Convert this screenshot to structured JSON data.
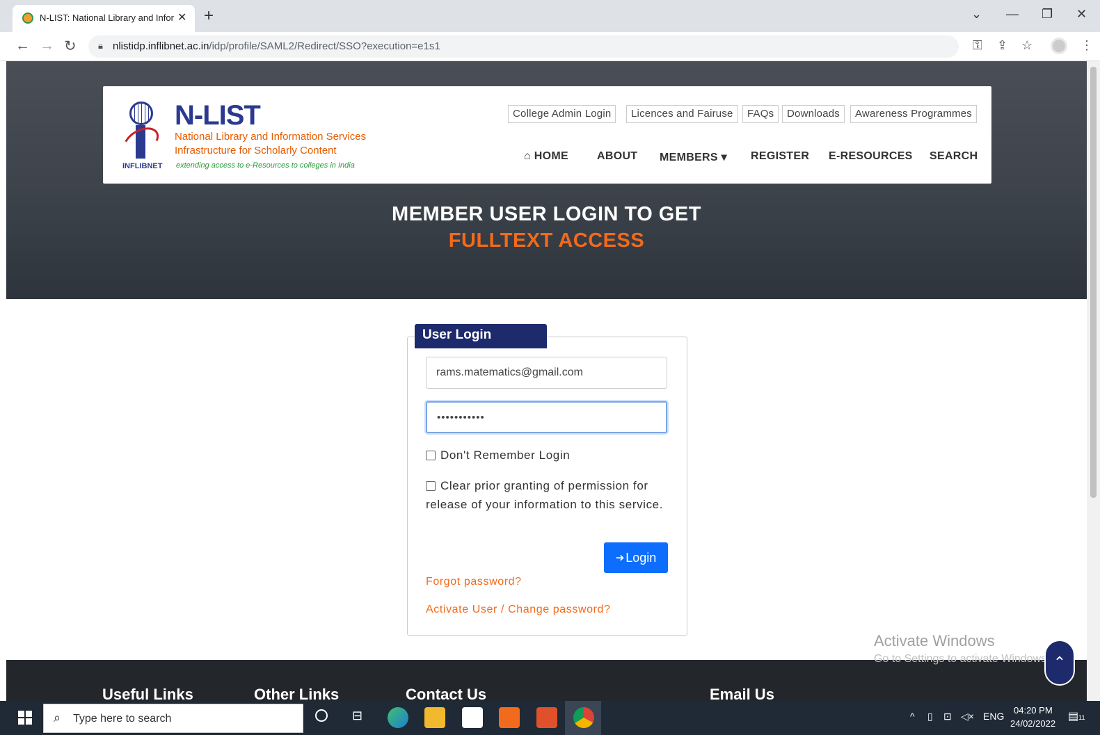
{
  "browser": {
    "tab_title": "N-LIST: National Library and Infor",
    "tab_close": "✕",
    "new_tab": "+",
    "url_host": "nlistidp.inflibnet.ac.in",
    "url_path": "/idp/profile/SAML2/Redirect/SSO?execution=e1s1"
  },
  "site": {
    "logo_text": "INFLIBNET",
    "brand": "N-LIST",
    "brand_sub1": "National Library and Information Services",
    "brand_sub2": "Infrastructure for Scholarly Content",
    "brand_tag": "extending access to e-Resources to colleges in India",
    "top_links": [
      "College Admin Login",
      "Licences and Fairuse",
      "FAQs",
      "Downloads",
      "Awareness Programmes"
    ],
    "nav": {
      "home": "HOME",
      "about": "ABOUT",
      "members": "MEMBERS",
      "register": "REGISTER",
      "eresources": "E-RESOURCES",
      "search": "SEARCH"
    },
    "hero_line1": "MEMBER USER LOGIN TO GET",
    "hero_line2": "FULLTEXT ACCESS"
  },
  "login": {
    "legend": "User Login",
    "username_value": "rams.matematics@gmail.com",
    "password_value": "•••••••••••",
    "dont_remember": "Don't Remember Login",
    "clear_prior_1": "Clear prior granting of permission for",
    "clear_prior_2": "release of your information to this service.",
    "login_button": "Login",
    "forgot": "Forgot password?",
    "activate": "Activate User / Change password?"
  },
  "watermark": {
    "line1": "Activate Windows",
    "line2": "Go to Settings to activate Windows."
  },
  "footer": {
    "useful": "Useful Links",
    "other": "Other Links",
    "contact": "Contact Us",
    "email": "Email Us"
  },
  "taskbar": {
    "search_placeholder": "Type here to search",
    "lang": "ENG",
    "time": "04:20 PM",
    "date": "24/02/2022",
    "notif_count": "11"
  },
  "colors": {
    "accent_orange": "#f26a1b",
    "navy": "#1d2a6b",
    "button_blue": "#0d6efd"
  }
}
